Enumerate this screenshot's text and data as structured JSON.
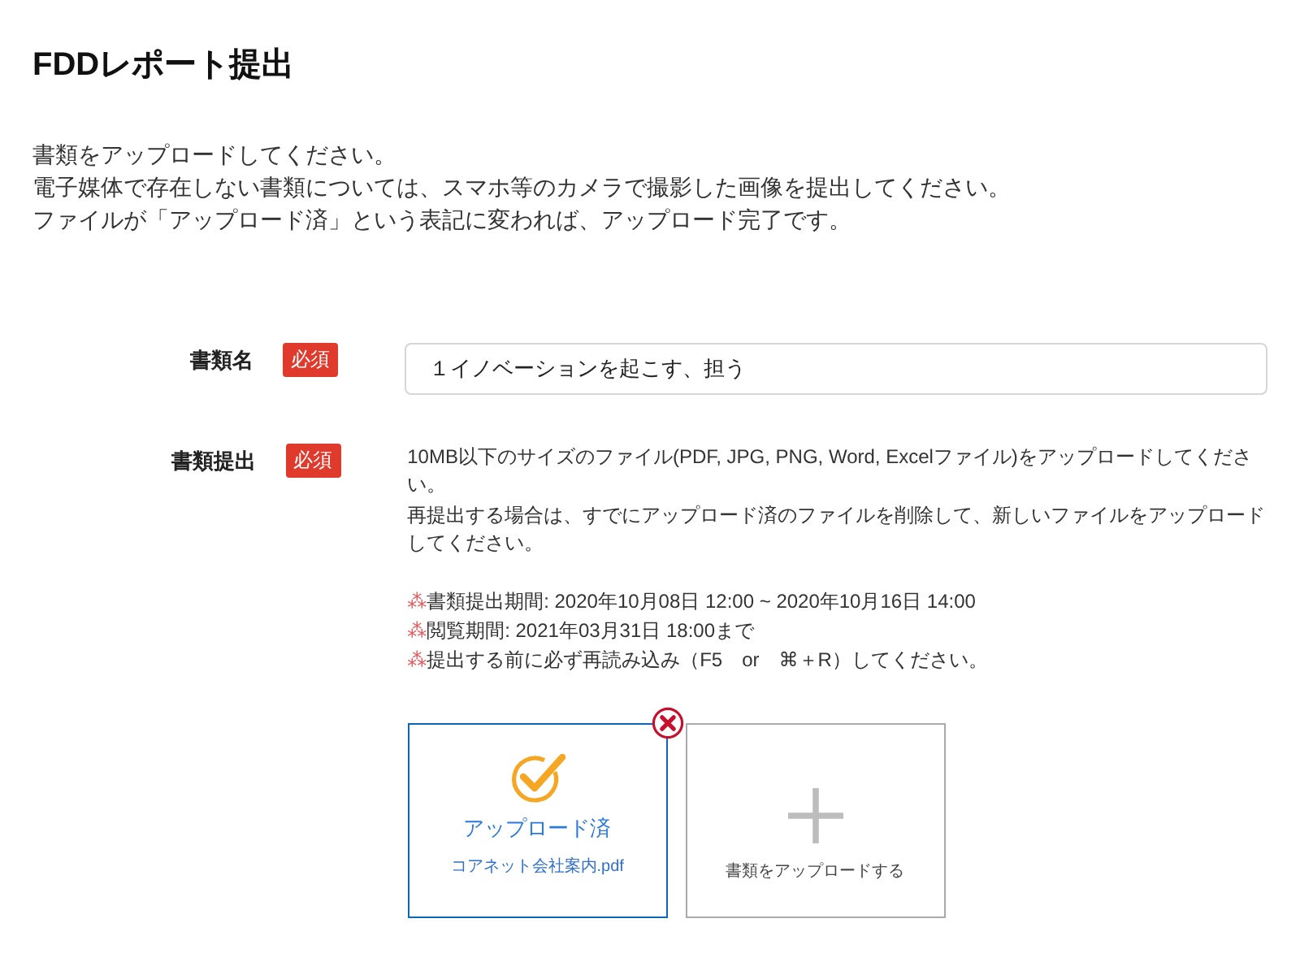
{
  "page": {
    "title": "FDDレポート提出"
  },
  "intro": [
    "書類をアップロードしてください。",
    "電子媒体で存在しない書類については、スマホ等のカメラで撮影した画像を提出してください。",
    "ファイルが「アップロード済」という表記に変われば、アップロード完了です。"
  ],
  "form": {
    "fields": [
      {
        "kind": "text",
        "label": "書類名",
        "required": true,
        "badge": "必須",
        "value": "１イノベーションを起こす、担う"
      },
      {
        "kind": "upload",
        "label": "書類提出",
        "required": true,
        "badge": "必須",
        "description": [
          "10MB以下のサイズのファイル(PDF, JPG, PNG, Word, Excelファイル)をアップロードしてください。",
          "再提出する場合は、すでにアップロード済のファイルを削除して、新しいファイルをアップロードしてください。"
        ],
        "notes": [
          {
            "mark": "⁂",
            "text": "書類提出期間: 2020年10月08日 12:00 ~ 2020年10月16日 14:00"
          },
          {
            "mark": "⁂",
            "text": "閲覧期間: 2021年03月31日 18:00まで"
          },
          {
            "mark": "⁂",
            "text": "提出する前に必ず再読み込み（F5　or　⌘＋R）してください。"
          }
        ],
        "files": [
          {
            "uploaded": true,
            "status": "アップロード済",
            "name": "コアネット会社案内.pdf"
          }
        ],
        "add_button": "書類をアップロードする"
      }
    ]
  }
}
